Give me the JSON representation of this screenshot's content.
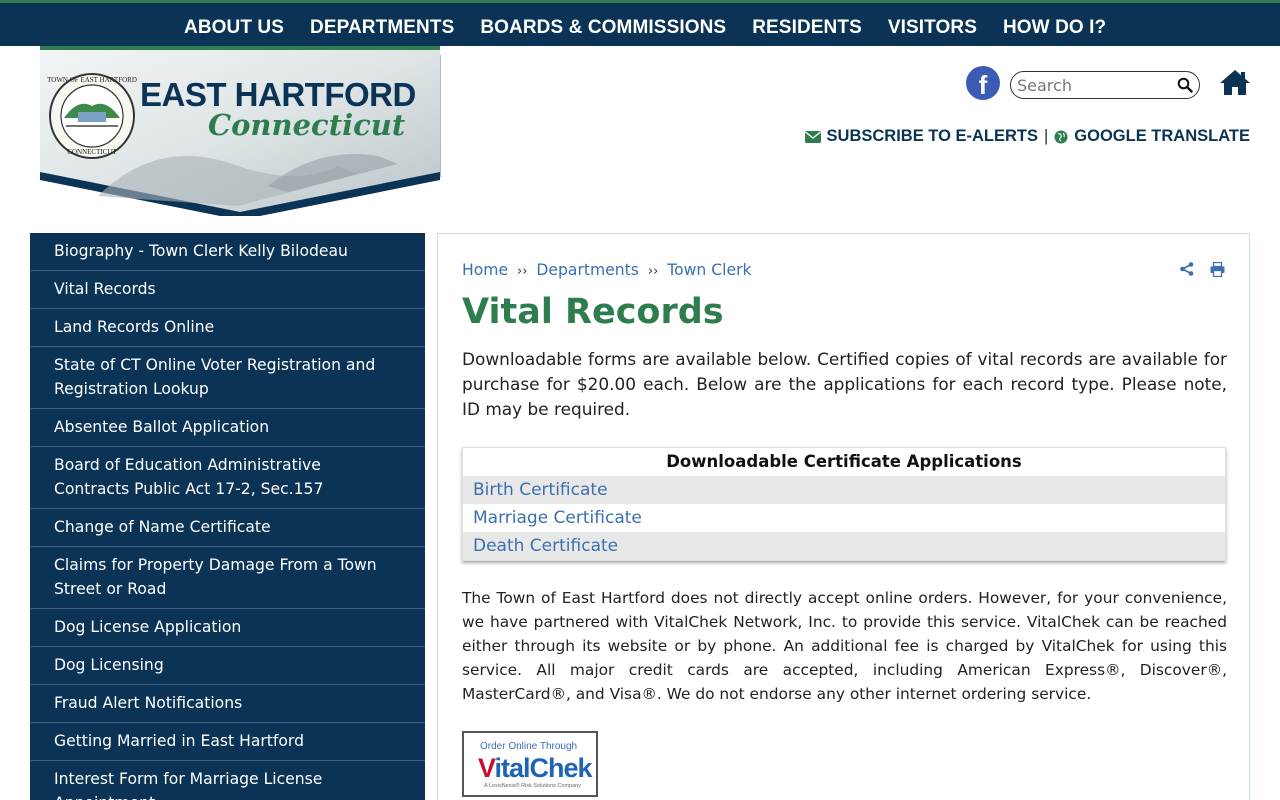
{
  "topnav": {
    "items": [
      "ABOUT US",
      "DEPARTMENTS",
      "BOARDS & COMMISSIONS",
      "RESIDENTS",
      "VISITORS",
      "HOW DO I?"
    ]
  },
  "logo": {
    "title": "EAST HARTFORD",
    "subtitle": "Connecticut",
    "seal_text": "TOWN OF EAST HARTFORD CONNECTICUT"
  },
  "header": {
    "facebook_letter": "f",
    "search_placeholder": "Search",
    "subscribe_label": "SUBSCRIBE TO E-ALERTS",
    "separator": "|",
    "translate_label": "GOOGLE TRANSLATE"
  },
  "sidebar": {
    "items": [
      "Biography - Town Clerk Kelly Bilodeau",
      "Vital Records",
      "Land Records Online",
      "State of CT Online Voter Registration and Registration Lookup",
      "Absentee Ballot Application",
      "Board of Education Administrative Contracts Public Act 17-2, Sec.157",
      "Change of Name Certificate",
      "Claims for Property Damage From a Town Street or Road",
      "Dog License Application",
      "Dog Licensing",
      "Fraud Alert Notifications",
      "Getting Married in East Hartford",
      "Interest Form for Marriage License Appointment"
    ]
  },
  "breadcrumb": {
    "home": "Home",
    "departments": "Departments",
    "town_clerk": "Town Clerk",
    "sep": "››"
  },
  "main": {
    "title": "Vital Records",
    "intro": "Downloadable forms are available below. Certified copies of vital records are avail­able for purchase for $20.00 each. Below are the applications for each record type. Please note, ID may be required.",
    "table": {
      "header": "Downloadable Certificate Applications",
      "rows": [
        "Birth Certificate",
        "Marriage Certificate",
        "Death Certificate"
      ]
    },
    "note": "The Town of East Hartford does not directly accept online orders. However, for your conve­nience, we have partnered with VitalChek Network, Inc. to provide this service. VitalChek can be reached either through its website or by phone. An additional fee is charged by VitalChek for using this service. All major credit cards are accepted, including American Express®, Discover®, MasterCard®, and Visa®. We do not endorse any other internet ordering service.",
    "vitalchek": {
      "order_text": "Order Online Through",
      "brand_v": "V",
      "brand_rest": "italChek",
      "tagline": "A LexisNexis® Risk Solutions Company"
    }
  },
  "colors": {
    "navy": "#0a3355",
    "green": "#2e7d4f",
    "link": "#3a6fb0"
  }
}
